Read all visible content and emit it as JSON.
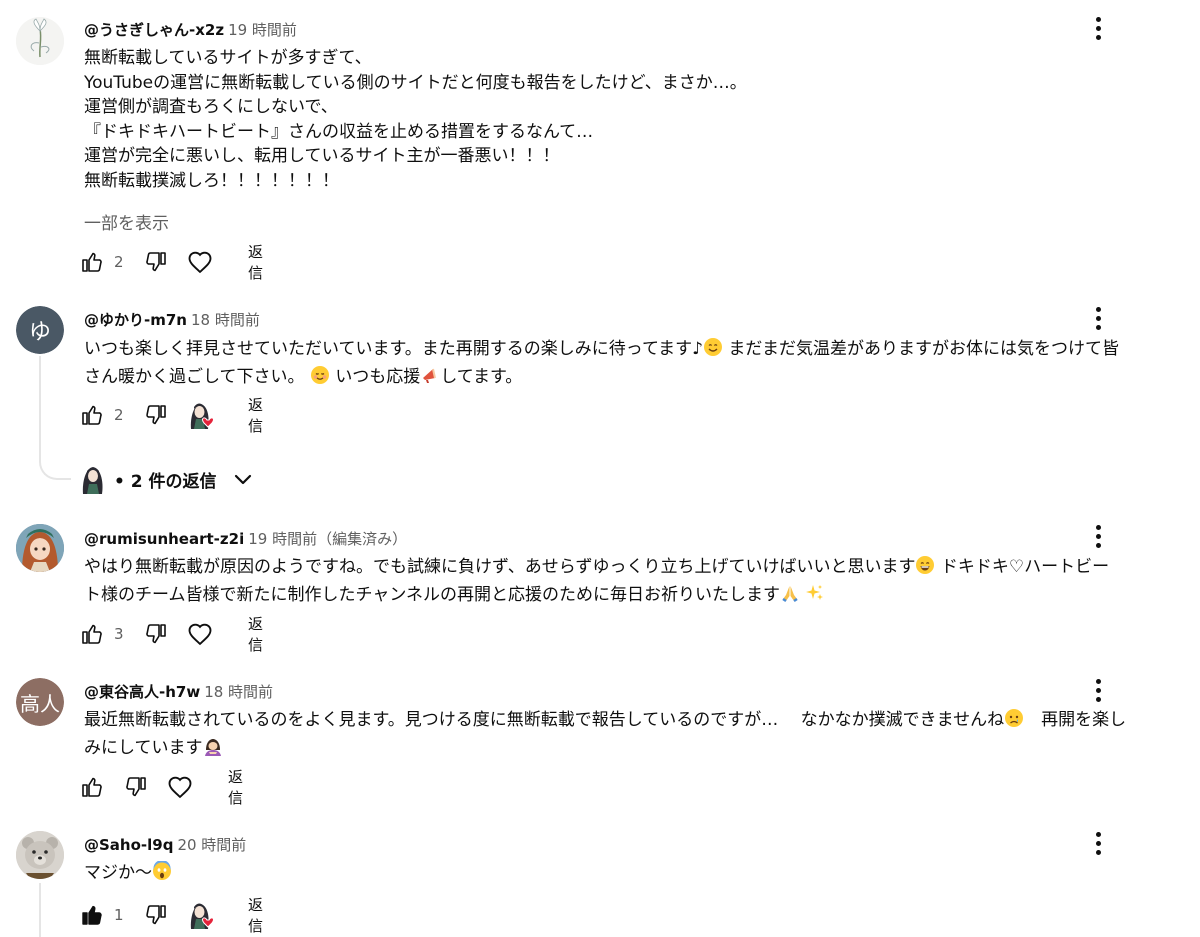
{
  "comments": [
    {
      "author": "@うさぎしゃん-x2z",
      "time": "19 時間前",
      "lines": [
        "無断転載しているサイトが多すぎて、",
        "YouTubeの運営に無断転載している側のサイトだと何度も報告をしたけど、まさか…。",
        "運営側が調査もろくにしないで、",
        "『ドキドキハートビート』さんの収益を止める措置をするなんて…",
        "運営が完全に悪いし、転用しているサイト主が一番悪い！！！",
        "無断転載撲滅しろ！！！！！！！"
      ],
      "show_more": "一部を表示",
      "likes": "2",
      "reply_label": "返信"
    },
    {
      "author": "@ゆかり-m7n",
      "avatar_letter": "ゆ",
      "time": "18 時間前",
      "text_a": "いつも楽しく拝見させていただいています。また再開するの楽しみに待ってます♪",
      "text_b": "まだまだ気温差がありますがお体には気をつけて皆さん暖かく過ごして下さい。",
      "text_c": "いつも応援",
      "text_d": "してます。",
      "likes": "2",
      "reply_label": "返信",
      "replies_label": "• 2 件の返信"
    },
    {
      "author": "@rumisunheart-z2i",
      "time": "19 時間前",
      "edited": "（編集済み）",
      "text_a": "やはり無断転載が原因のようですね。でも試練に負けず、あせらずゆっくり立ち上げていけばいいと思います",
      "text_b": "ドキドキ♡ハートビート様のチーム皆様で新たに制作したチャンネルの再開と応援のために毎日お祈りいたします",
      "likes": "3",
      "reply_label": "返信"
    },
    {
      "author": "@東谷高人-h7w",
      "avatar_letter": "高人",
      "time": "18 時間前",
      "text_a": "最近無断転載されているのをよく見ます。見つける度に無断転載で報告しているのですが…　 なかなか撲滅できませんね",
      "text_b": "　再開を楽しみにしています",
      "likes": "",
      "reply_label": "返信"
    },
    {
      "author": "@Saho-l9q",
      "time": "20 時間前",
      "text_a": "マジか〜",
      "likes": "1",
      "reply_label": "返信"
    }
  ],
  "colors": {
    "avatar_yukari": "#4a5865",
    "avatar_higashi": "#8d6e63",
    "heart_red": "#e5243b",
    "secondary_text": "#606060"
  }
}
